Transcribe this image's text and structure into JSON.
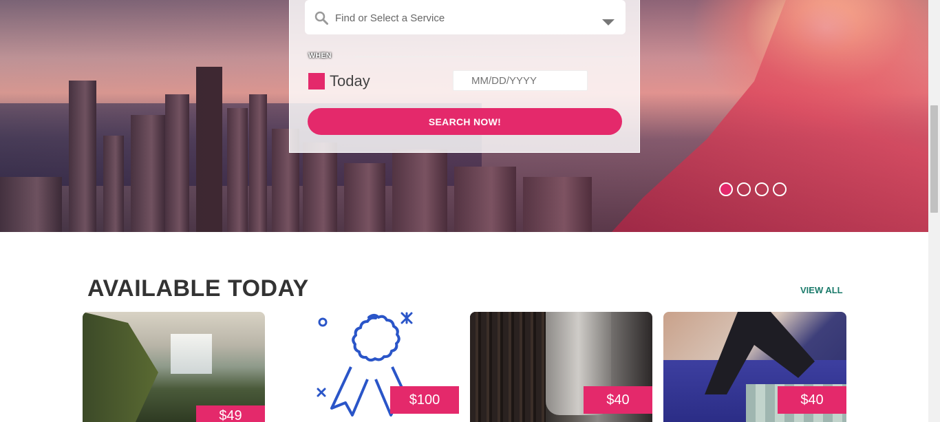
{
  "search": {
    "service_placeholder": "Find or Select a Service",
    "when_label": "WHEN",
    "today_label": "Today",
    "date_placeholder": "MM/DD/YYYY",
    "button_label": "SEARCH NOW!"
  },
  "carousel": {
    "slide_count": 4,
    "active_index": 0
  },
  "section": {
    "title": "AVAILABLE TODAY",
    "view_all": "VIEW ALL"
  },
  "cards": [
    {
      "price": "$49",
      "image": "waterfall"
    },
    {
      "price": "$100",
      "image": "award-ribbon-icon"
    },
    {
      "price": "$40",
      "image": "bookshelf-sleeve"
    },
    {
      "price": "$40",
      "image": "yoga-mat"
    }
  ],
  "colors": {
    "accent": "#e4296b",
    "link": "#1a7a6a"
  }
}
